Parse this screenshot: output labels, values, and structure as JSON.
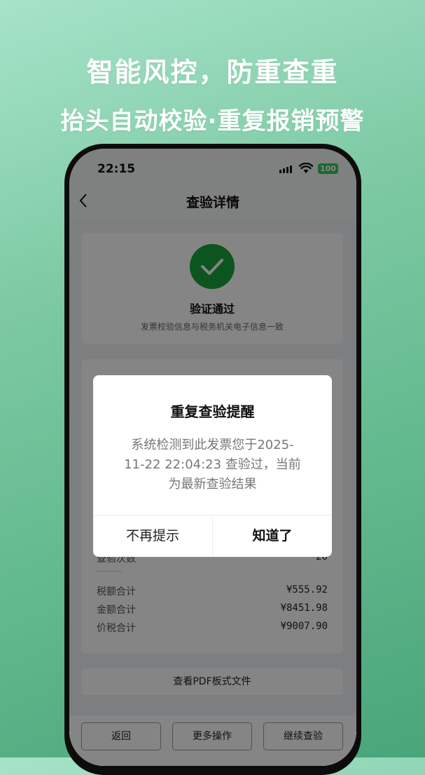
{
  "headline": {
    "line1": "智能风控，防重查重",
    "line2": "抬头自动校验·重复报销预警"
  },
  "status_bar": {
    "time": "22:15",
    "battery": "100"
  },
  "nav": {
    "title": "查验详情"
  },
  "result_card": {
    "status": "验证通过",
    "description": "发票校验信息与税务机关电子信息一致"
  },
  "details": {
    "check_count_label": "查验次数",
    "check_count_value": "20",
    "tax_label": "税额合计",
    "tax_value": "¥555.92",
    "amount_label": "金额合计",
    "amount_value": "¥8451.98",
    "total_label": "价税合计",
    "total_value": "¥9007.90"
  },
  "pdf_button": "查看PDF板式文件",
  "bottom_bar": {
    "back": "返回",
    "more": "更多操作",
    "continue": "继续查验"
  },
  "modal": {
    "title": "重复查验提醒",
    "body": "系统检测到此发票您于2025-11-22 22:04:23 查验过，当前为最新查验结果",
    "dismiss": "不再提示",
    "confirm": "知道了"
  },
  "colors": {
    "success": "#1aa33a",
    "battery": "#34c759",
    "overlay": "rgba(0,0,0,0.48)"
  }
}
